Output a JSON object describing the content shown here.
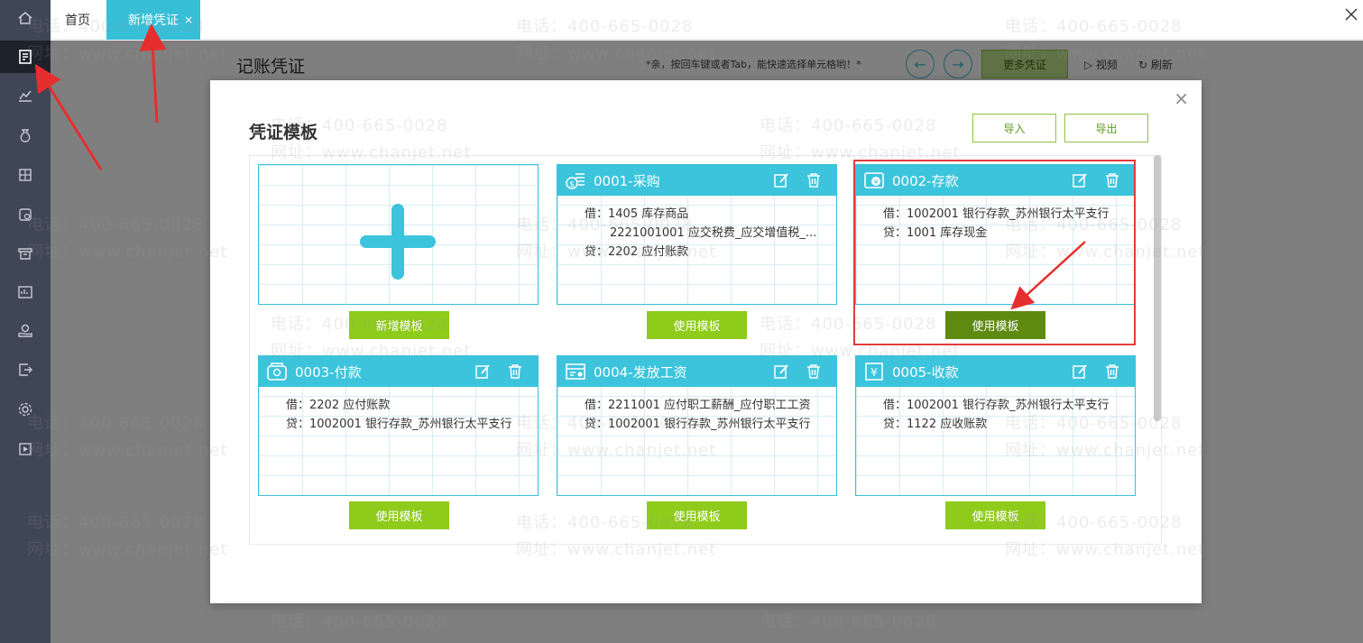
{
  "sidebar": {
    "items": [
      {
        "icon": "home-icon"
      },
      {
        "icon": "voucher-icon",
        "active": true
      },
      {
        "icon": "chart-icon"
      },
      {
        "icon": "money-bag-icon"
      },
      {
        "icon": "ledger-icon"
      },
      {
        "icon": "report-icon"
      },
      {
        "icon": "store-icon"
      },
      {
        "icon": "invoice-icon"
      },
      {
        "icon": "hand-coin-icon"
      },
      {
        "icon": "export-icon"
      },
      {
        "icon": "settings-icon"
      },
      {
        "icon": "video-icon"
      }
    ]
  },
  "tabs": {
    "home": "首页",
    "active": "新增凭证",
    "close": "×"
  },
  "page": {
    "title": "记账凭证",
    "tip": "*亲，按回车键或者Tab，能快速选择单元格哟！*",
    "more_button": "更多凭证",
    "video_link": "视频",
    "refresh_link": "刷新"
  },
  "modal": {
    "title": "凭证模板",
    "close": "×",
    "import_button": "导入",
    "export_button": "导出",
    "new_template_button": "新增模板",
    "use_template_button": "使用模板",
    "templates": [
      {
        "title": "0001-采购",
        "icon": "purchase-icon",
        "lines": [
          "借：1405 库存商品",
          "2221001001 应交税费_应交增值税_...",
          "贷：2202 应付账款"
        ]
      },
      {
        "title": "0002-存款",
        "icon": "deposit-icon",
        "lines": [
          "借：1002001 银行存款_苏州银行太平支行",
          "贷：1001 库存现金"
        ]
      },
      {
        "title": "0003-付款",
        "icon": "payment-icon",
        "lines": [
          "借：2202 应付账款",
          "贷：1002001 银行存款_苏州银行太平支行"
        ]
      },
      {
        "title": "0004-发放工资",
        "icon": "salary-icon",
        "lines": [
          "借：2211001 应付职工薪酬_应付职工工资",
          "贷：1002001 银行存款_苏州银行太平支行"
        ]
      },
      {
        "title": "0005-收款",
        "icon": "receipt-icon",
        "lines": [
          "借：1002001 银行存款_苏州银行太平支行",
          "贷：1122 应收账款"
        ]
      }
    ]
  },
  "watermark": {
    "phone": "电话：400-665-0028",
    "site": "网址：www.chanjet.net"
  },
  "colors": {
    "sidebar": "#3f4656",
    "accent": "#38bfd8",
    "green": "#8fcb1b",
    "highlight": "#e23b3b"
  }
}
